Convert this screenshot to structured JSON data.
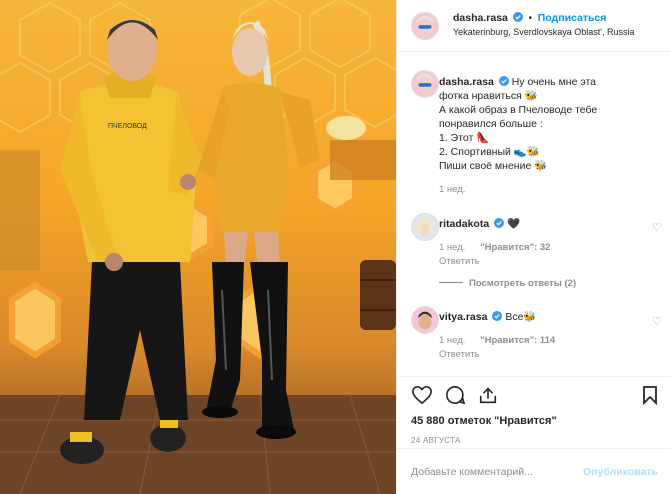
{
  "post": {
    "author": "dasha.rasa",
    "follow_label": "Подписаться",
    "separator": "•",
    "location": "Yekaterinburg, Sverdlovskaya Oblast', Russia",
    "more_icon": "ellipsis-icon",
    "photo_print": "ПЧЕЛОВОД",
    "caption": {
      "author": "dasha.rasa",
      "lines": [
        "Ну очень мне эта",
        "фотка нравиться 🐝",
        "А какой образ в Пчеловоде тебе",
        "понравился больше :",
        "1. Этот 👠",
        "2. Спортивный 👟🐝",
        "Пиши своё мнение 🐝"
      ],
      "time": "1 нед."
    },
    "comments": [
      {
        "user": "ritadakota",
        "text": "🖤",
        "time": "1 нед.",
        "likes": "\"Нравится\": 32",
        "reply": "Ответить",
        "view_replies": "Посмотреть ответы (2)"
      },
      {
        "user": "vitya.rasa",
        "text": "Все🐝",
        "time": "1 нед.",
        "likes": "\"Нравится\": 114",
        "reply": "Ответить"
      }
    ],
    "likes_text": "45 880 отметок \"Нравится\"",
    "date": "24 АВГУСТА",
    "add_comment_placeholder": "Добавьте комментарий...",
    "publish_label": "Опубликовать"
  },
  "colors": {
    "accent": "#0095f6",
    "muted": "#8e8e8e",
    "publish_disabled": "#b2dffc",
    "hoodie": "#f1c232",
    "latex": "#e7a72a"
  }
}
